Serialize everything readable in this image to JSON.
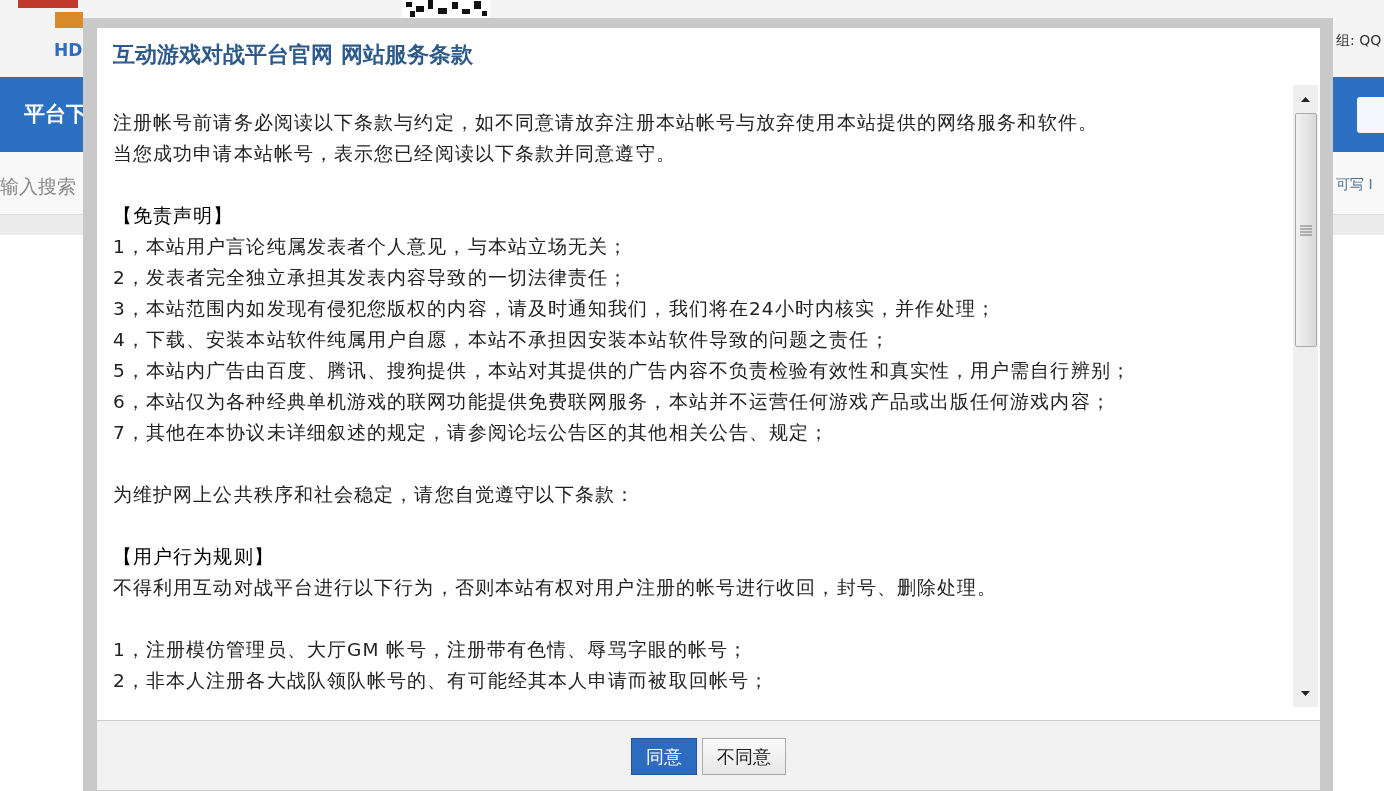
{
  "background_page": {
    "logo_text": "HD",
    "nav_button": "平台下",
    "search": {
      "placeholder": "输入搜索"
    },
    "header_right": "组: QQ",
    "search_right": "可写 I"
  },
  "dialog": {
    "title": "互动游戏对战平台官网 网站服务条款",
    "blocks": [
      {
        "lines": [
          {
            "kind": "text",
            "text": "注册帐号前请务必阅读以下条款与约定，如不同意请放弃注册本站帐号与放弃使用本站提供的网络服务和软件。"
          },
          {
            "kind": "text",
            "text": "当您成功申请本站帐号，表示您已经阅读以下条款并同意遵守。"
          }
        ]
      },
      {
        "lines": [
          {
            "kind": "heading",
            "text": "【免责声明】"
          },
          {
            "kind": "text",
            "text": "1，本站用户言论纯属发表者个人意见，与本站立场无关；"
          },
          {
            "kind": "text",
            "text": "2，发表者完全独立承担其发表内容导致的一切法律责任；"
          },
          {
            "kind": "text",
            "text": "3，本站范围内如发现有侵犯您版权的内容，请及时通知我们，我们将在24小时内核实，并作处理；"
          },
          {
            "kind": "text",
            "text": "4，下载、安装本站软件纯属用户自愿，本站不承担因安装本站软件导致的问题之责任；"
          },
          {
            "kind": "text",
            "text": "5，本站内广告由百度、腾讯、搜狗提供，本站对其提供的广告内容不负责检验有效性和真实性，用户需自行辨别；"
          },
          {
            "kind": "text",
            "text": "6，本站仅为各种经典单机游戏的联网功能提供免费联网服务，本站并不运营任何游戏产品或出版任何游戏内容；"
          },
          {
            "kind": "text",
            "text": "7，其他在本协议未详细叙述的规定，请参阅论坛公告区的其他相关公告、规定；"
          }
        ]
      },
      {
        "lines": [
          {
            "kind": "text",
            "text": "为维护网上公共秩序和社会稳定，请您自觉遵守以下条款："
          }
        ]
      },
      {
        "lines": [
          {
            "kind": "heading",
            "text": "【用户行为规则】"
          },
          {
            "kind": "text",
            "text": "不得利用互动对战平台进行以下行为，否则本站有权对用户注册的帐号进行收回，封号、删除处理。"
          }
        ]
      },
      {
        "lines": [
          {
            "kind": "text",
            "text": "1，注册模仿管理员、大厅GM 帐号，注册带有色情、辱骂字眼的帐号；"
          },
          {
            "kind": "text",
            "text": "2，非本人注册各大战队领队帐号的、有可能经其本人申请而被取回帐号；"
          }
        ]
      }
    ],
    "buttons": [
      {
        "label": "同意",
        "primary": true
      },
      {
        "label": "不同意",
        "primary": false
      }
    ]
  }
}
